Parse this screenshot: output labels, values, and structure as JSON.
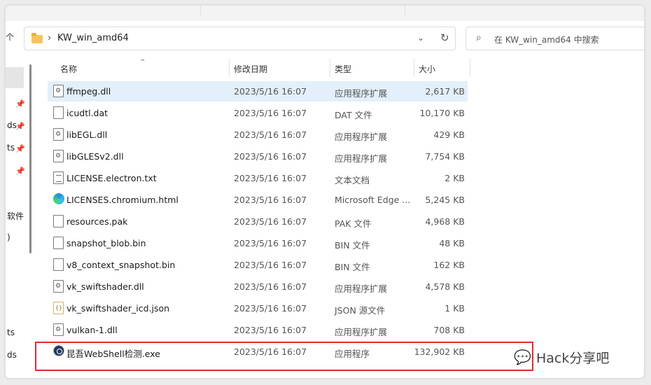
{
  "address": {
    "path": "KW_win_amd64"
  },
  "search": {
    "placeholder": "在 KW_win_amd64 中搜索"
  },
  "nav": {
    "up_label": "个"
  },
  "sidebar": {
    "texts": [
      "ds",
      "ts",
      "软件",
      ")",
      "ts",
      "ds"
    ]
  },
  "columns": {
    "name": "名称",
    "date": "修改日期",
    "type": "类型",
    "size": "大小"
  },
  "files": [
    {
      "name": "ffmpeg.dll",
      "date": "2023/5/16 16:07",
      "type": "应用程序扩展",
      "size": "2,617 KB",
      "icon": "dll-file-icon",
      "selected": true
    },
    {
      "name": "icudtl.dat",
      "date": "2023/5/16 16:07",
      "type": "DAT 文件",
      "size": "10,170 KB",
      "icon": "file-icon"
    },
    {
      "name": "libEGL.dll",
      "date": "2023/5/16 16:07",
      "type": "应用程序扩展",
      "size": "429 KB",
      "icon": "dll-file-icon"
    },
    {
      "name": "libGLESv2.dll",
      "date": "2023/5/16 16:07",
      "type": "应用程序扩展",
      "size": "7,754 KB",
      "icon": "dll-file-icon"
    },
    {
      "name": "LICENSE.electron.txt",
      "date": "2023/5/16 16:07",
      "type": "文本文档",
      "size": "2 KB",
      "icon": "text-file-icon"
    },
    {
      "name": "LICENSES.chromium.html",
      "date": "2023/5/16 16:07",
      "type": "Microsoft Edge ...",
      "size": "5,245 KB",
      "icon": "edge-icon"
    },
    {
      "name": "resources.pak",
      "date": "2023/5/16 16:07",
      "type": "PAK 文件",
      "size": "4,968 KB",
      "icon": "file-icon"
    },
    {
      "name": "snapshot_blob.bin",
      "date": "2023/5/16 16:07",
      "type": "BIN 文件",
      "size": "48 KB",
      "icon": "file-icon"
    },
    {
      "name": "v8_context_snapshot.bin",
      "date": "2023/5/16 16:07",
      "type": "BIN 文件",
      "size": "162 KB",
      "icon": "file-icon"
    },
    {
      "name": "vk_swiftshader.dll",
      "date": "2023/5/16 16:07",
      "type": "应用程序扩展",
      "size": "4,578 KB",
      "icon": "dll-file-icon"
    },
    {
      "name": "vk_swiftshader_icd.json",
      "date": "2023/5/16 16:07",
      "type": "JSON 源文件",
      "size": "1 KB",
      "icon": "json-file-icon"
    },
    {
      "name": "vulkan-1.dll",
      "date": "2023/5/16 16:07",
      "type": "应用程序扩展",
      "size": "708 KB",
      "icon": "dll-file-icon"
    },
    {
      "name": "昆吾WebShell检测.exe",
      "date": "2023/5/16 16:07",
      "type": "应用程序",
      "size": "132,902 KB",
      "icon": "exe-app-icon"
    }
  ],
  "watermark": {
    "text": "Hack分享吧",
    "icon": "wechat-icon"
  }
}
